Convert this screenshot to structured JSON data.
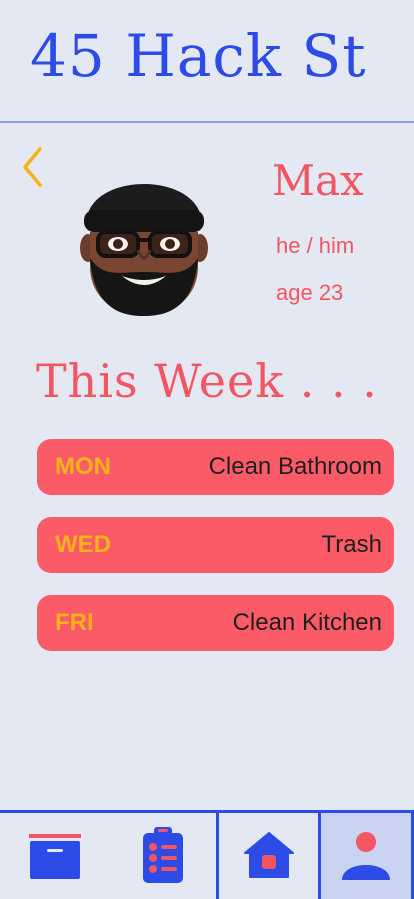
{
  "header": {
    "title": "45 Hack St"
  },
  "profile": {
    "name": "Max",
    "pronouns": "he / him",
    "age": "age 23"
  },
  "section": {
    "title": "This Week . . ."
  },
  "chores": [
    {
      "day": "MON",
      "task": "Clean Bathroom"
    },
    {
      "day": "WED",
      "task": "Trash"
    },
    {
      "day": "FRI",
      "task": "Clean Kitchen"
    }
  ],
  "colors": {
    "primary": "#2d4be6",
    "accent": "#f25662",
    "chore_bg": "#fb5a67",
    "day_text": "#f6b21a",
    "back_arrow": "#f6b21a",
    "background": "#e4e8f2"
  },
  "nav": {
    "items": [
      {
        "icon": "inbox-icon"
      },
      {
        "icon": "task-list-icon"
      },
      {
        "icon": "home-icon"
      },
      {
        "icon": "profile-icon",
        "active": true
      }
    ]
  }
}
